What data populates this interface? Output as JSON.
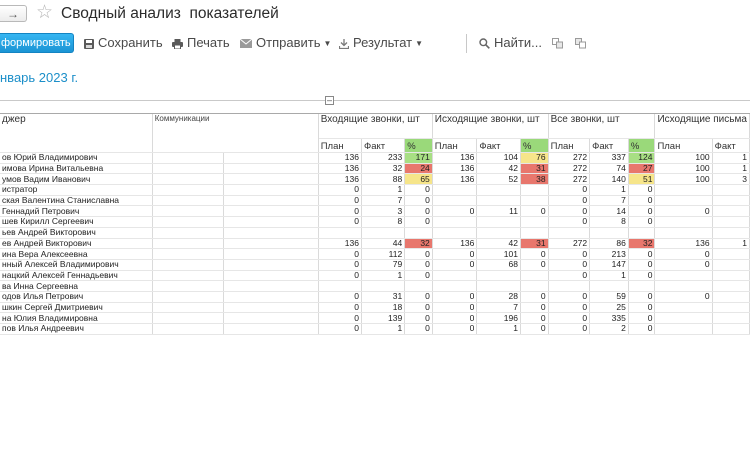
{
  "window": {
    "nav_arrow": "→",
    "title": "Сводный анализ  показателей"
  },
  "toolbar": {
    "generate": "формировать",
    "save": "Сохранить",
    "print": "Печать",
    "send": "Отправить",
    "result": "Результат",
    "find": "Найти..."
  },
  "period": "нварь 2023 г.",
  "table": {
    "col_manager": "джер",
    "col_comm": "Коммуникации",
    "groups": [
      "Входящие звонки, шт",
      "Исходящие звонки, шт",
      "Все звонки, шт",
      "Исходящие письма"
    ],
    "sub": [
      "План",
      "Факт",
      "%"
    ],
    "rows": [
      {
        "name": "ов Юрий Владимирович",
        "v": [
          "136",
          "233",
          "171",
          "136",
          "104",
          "76",
          "272",
          "337",
          "124",
          "100",
          "1"
        ],
        "c": [
          "",
          "",
          "green",
          "",
          "",
          "yellow",
          "",
          "",
          "green",
          "",
          ""
        ]
      },
      {
        "name": "имова Ирина Витальевна",
        "v": [
          "136",
          "32",
          "24",
          "136",
          "42",
          "31",
          "272",
          "74",
          "27",
          "100",
          "1"
        ],
        "c": [
          "",
          "",
          "red",
          "",
          "",
          "red",
          "",
          "",
          "red",
          "",
          ""
        ]
      },
      {
        "name": "умов Вадим Иванович",
        "v": [
          "136",
          "88",
          "65",
          "136",
          "52",
          "38",
          "272",
          "140",
          "51",
          "100",
          "3"
        ],
        "c": [
          "",
          "",
          "yellow",
          "",
          "",
          "red",
          "",
          "",
          "yellow",
          "",
          ""
        ]
      },
      {
        "name": "истратор",
        "v": [
          "0",
          "1",
          "0",
          "",
          "",
          "",
          "0",
          "1",
          "0",
          "",
          ""
        ],
        "c": [
          "",
          "",
          "",
          "",
          "",
          "",
          "",
          "",
          "",
          "",
          ""
        ]
      },
      {
        "name": "ская Валентина Станиславна",
        "v": [
          "0",
          "7",
          "0",
          "",
          "",
          "",
          "0",
          "7",
          "0",
          "",
          ""
        ],
        "c": [
          "",
          "",
          "",
          "",
          "",
          "",
          "",
          "",
          "",
          "",
          ""
        ]
      },
      {
        "name": " Геннадий Петрович",
        "v": [
          "0",
          "3",
          "0",
          "0",
          "11",
          "0",
          "0",
          "14",
          "0",
          "0",
          ""
        ],
        "c": [
          "",
          "",
          "",
          "",
          "",
          "",
          "",
          "",
          "",
          "",
          ""
        ]
      },
      {
        "name": "шев Кирилл Сергеевич",
        "v": [
          "0",
          "8",
          "0",
          "",
          "",
          "",
          "0",
          "8",
          "0",
          "",
          ""
        ],
        "c": [
          "",
          "",
          "",
          "",
          "",
          "",
          "",
          "",
          "",
          "",
          ""
        ]
      },
      {
        "name": "ьев Андрей Викторович",
        "v": [
          "",
          "",
          "",
          "",
          "",
          "",
          "",
          "",
          "",
          "",
          ""
        ],
        "c": [
          "",
          "",
          "",
          "",
          "",
          "",
          "",
          "",
          "",
          "",
          ""
        ]
      },
      {
        "name": "ев Андрей Викторович",
        "v": [
          "136",
          "44",
          "32",
          "136",
          "42",
          "31",
          "272",
          "86",
          "32",
          "136",
          "1"
        ],
        "c": [
          "",
          "",
          "red",
          "",
          "",
          "red",
          "",
          "",
          "red",
          "",
          ""
        ]
      },
      {
        "name": "ина Вера Алексеевна",
        "v": [
          "0",
          "112",
          "0",
          "0",
          "101",
          "0",
          "0",
          "213",
          "0",
          "0",
          ""
        ],
        "c": [
          "",
          "",
          "",
          "",
          "",
          "",
          "",
          "",
          "",
          "",
          ""
        ]
      },
      {
        "name": "нный Алексей Владимирович",
        "v": [
          "0",
          "79",
          "0",
          "0",
          "68",
          "0",
          "0",
          "147",
          "0",
          "0",
          ""
        ],
        "c": [
          "",
          "",
          "",
          "",
          "",
          "",
          "",
          "",
          "",
          "",
          ""
        ]
      },
      {
        "name": "нацкий Алексей Геннадьевич",
        "v": [
          "0",
          "1",
          "0",
          "",
          "",
          "",
          "0",
          "1",
          "0",
          "",
          ""
        ],
        "c": [
          "",
          "",
          "",
          "",
          "",
          "",
          "",
          "",
          "",
          "",
          ""
        ]
      },
      {
        "name": "ва Инна Сергеевна",
        "v": [
          "",
          "",
          "",
          "",
          "",
          "",
          "",
          "",
          "",
          "",
          ""
        ],
        "c": [
          "",
          "",
          "",
          "",
          "",
          "",
          "",
          "",
          "",
          "",
          ""
        ]
      },
      {
        "name": "одов Илья Петрович",
        "v": [
          "0",
          "31",
          "0",
          "0",
          "28",
          "0",
          "0",
          "59",
          "0",
          "0",
          ""
        ],
        "c": [
          "",
          "",
          "",
          "",
          "",
          "",
          "",
          "",
          "",
          "",
          ""
        ]
      },
      {
        "name": "шкин Сергей Дмитриевич",
        "v": [
          "0",
          "18",
          "0",
          "0",
          "7",
          "0",
          "0",
          "25",
          "0",
          "",
          ""
        ],
        "c": [
          "",
          "",
          "",
          "",
          "",
          "",
          "",
          "",
          "",
          "",
          ""
        ]
      },
      {
        "name": "на Юлия Владимировна",
        "v": [
          "0",
          "139",
          "0",
          "0",
          "196",
          "0",
          "0",
          "335",
          "0",
          "",
          ""
        ],
        "c": [
          "",
          "",
          "",
          "",
          "",
          "",
          "",
          "",
          "",
          "",
          ""
        ]
      },
      {
        "name": "пов Илья Андреевич",
        "v": [
          "0",
          "1",
          "0",
          "0",
          "1",
          "0",
          "0",
          "2",
          "0",
          "",
          ""
        ],
        "c": [
          "",
          "",
          "",
          "",
          "",
          "",
          "",
          "",
          "",
          "",
          ""
        ]
      }
    ]
  }
}
